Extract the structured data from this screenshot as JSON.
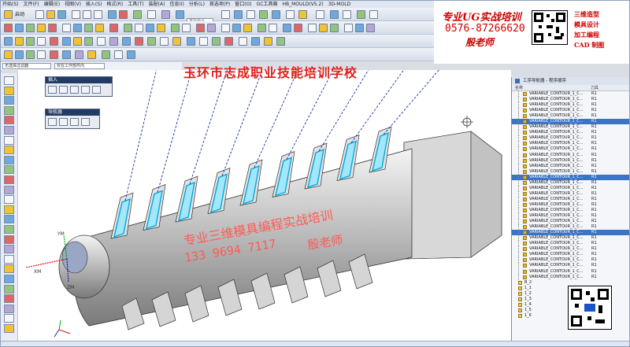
{
  "menubar": [
    "开始(S)",
    "文件(F)",
    "编辑(E)",
    "视图(V)",
    "插入(S)",
    "格式(R)",
    "工具(T)",
    "装配(A)",
    "信息(I)",
    "分析(L)",
    "首选项(P)",
    "窗口(O)",
    "GC工具箱",
    "HB_MOULD(V5.2)",
    "3D-MOLD"
  ],
  "toolbar": {
    "start_label": "启动",
    "search_placeholder": "查找命令"
  },
  "filters": {
    "type_filter": "无选择过滤器",
    "scope_filter": "仅在工作部件内"
  },
  "palettes": {
    "insert_title": "插入",
    "navigator_title": "导航器"
  },
  "banner": {
    "line1": "专业UG实战培训",
    "phone": "0576-87266620",
    "teacher": "殷老师",
    "side_lines": [
      "三维造型",
      "模具设计",
      "加工编程",
      "CAD 制图"
    ]
  },
  "watermark": {
    "school": "玉环市志成职业技能培训学校",
    "slogan": "专业三维模具编程实战培训",
    "phone": "133 9694 7117",
    "name": "殷老师"
  },
  "axes": {
    "xm": "XM",
    "ym": "YM",
    "zm": "ZM"
  },
  "navigator": {
    "title": "工序导航器 - 程序顺序",
    "col_name": "名称",
    "col_tool": "刀具",
    "rows": [
      {
        "name": "VARIABLE_CONTOUR_1_C...",
        "tool": "R1",
        "selected": false
      },
      {
        "name": "VARIABLE_CONTOUR_1_C...",
        "tool": "R1",
        "selected": false
      },
      {
        "name": "VARIABLE_CONTOUR_1_C...",
        "tool": "R1",
        "selected": false
      },
      {
        "name": "VARIABLE_CONTOUR_1_C...",
        "tool": "R1",
        "selected": false
      },
      {
        "name": "VARIABLE_CONTOUR_1_C...",
        "tool": "R1",
        "selected": false
      },
      {
        "name": "VARIABLE_CONTOUR_1_C...",
        "tool": "R1",
        "selected": true
      },
      {
        "name": "VARIABLE_CONTOUR_1_C...",
        "tool": "R1",
        "selected": false
      },
      {
        "name": "VARIABLE_CONTOUR_1_C...",
        "tool": "R1",
        "selected": false
      },
      {
        "name": "VARIABLE_CONTOUR_1_C...",
        "tool": "R1",
        "selected": false
      },
      {
        "name": "VARIABLE_CONTOUR_1_C...",
        "tool": "R1",
        "selected": false
      },
      {
        "name": "VARIABLE_CONTOUR_1_C...",
        "tool": "R1",
        "selected": false
      },
      {
        "name": "VARIABLE_CONTOUR_1_C...",
        "tool": "R1",
        "selected": false
      },
      {
        "name": "VARIABLE_CONTOUR_1_C...",
        "tool": "R1",
        "selected": false
      },
      {
        "name": "VARIABLE_CONTOUR_1_C...",
        "tool": "R1",
        "selected": false
      },
      {
        "name": "VARIABLE_CONTOUR_1_C...",
        "tool": "R1",
        "selected": false
      },
      {
        "name": "VARIABLE_CONTOUR_1_C...",
        "tool": "R1",
        "selected": true
      },
      {
        "name": "VARIABLE_CONTOUR_1_C...",
        "tool": "R1",
        "selected": false
      },
      {
        "name": "VARIABLE_CONTOUR_1_C...",
        "tool": "R1",
        "selected": false
      },
      {
        "name": "VARIABLE_CONTOUR_1_C...",
        "tool": "R1",
        "selected": false
      },
      {
        "name": "VARIABLE_CONTOUR_1_C...",
        "tool": "R1",
        "selected": false
      },
      {
        "name": "VARIABLE_CONTOUR_1_C...",
        "tool": "R1",
        "selected": false
      },
      {
        "name": "VARIABLE_CONTOUR_1_C...",
        "tool": "R1",
        "selected": false
      },
      {
        "name": "VARIABLE_CONTOUR_1_C...",
        "tool": "R1",
        "selected": false
      },
      {
        "name": "VARIABLE_CONTOUR_1_C...",
        "tool": "R1",
        "selected": false
      },
      {
        "name": "VARIABLE_CONTOUR_1_C...",
        "tool": "R1",
        "selected": false
      },
      {
        "name": "VARIABLE_CONTOUR_1_C...",
        "tool": "R1",
        "selected": true
      },
      {
        "name": "VARIABLE_CONTOUR_1_C...",
        "tool": "R1",
        "selected": false
      },
      {
        "name": "VARIABLE_CONTOUR_1_C...",
        "tool": "R1",
        "selected": false
      },
      {
        "name": "VARIABLE_CONTOUR_1_C...",
        "tool": "R1",
        "selected": false
      },
      {
        "name": "VARIABLE_CONTOUR_1_C...",
        "tool": "R1",
        "selected": false
      },
      {
        "name": "VARIABLE_CONTOUR_1_C...",
        "tool": "R1",
        "selected": false
      },
      {
        "name": "VARIABLE_CONTOUR_1_C...",
        "tool": "R1",
        "selected": false
      },
      {
        "name": "VARIABLE_CONTOUR_1_C...",
        "tool": "R1",
        "selected": false
      },
      {
        "name": "VARIABLE_CONTOUR_1_C...",
        "tool": "R1",
        "selected": false
      }
    ],
    "groups": [
      "B_2",
      "1_1",
      "1_2",
      "1_3",
      "1_4",
      "1_5",
      "1_6"
    ]
  }
}
